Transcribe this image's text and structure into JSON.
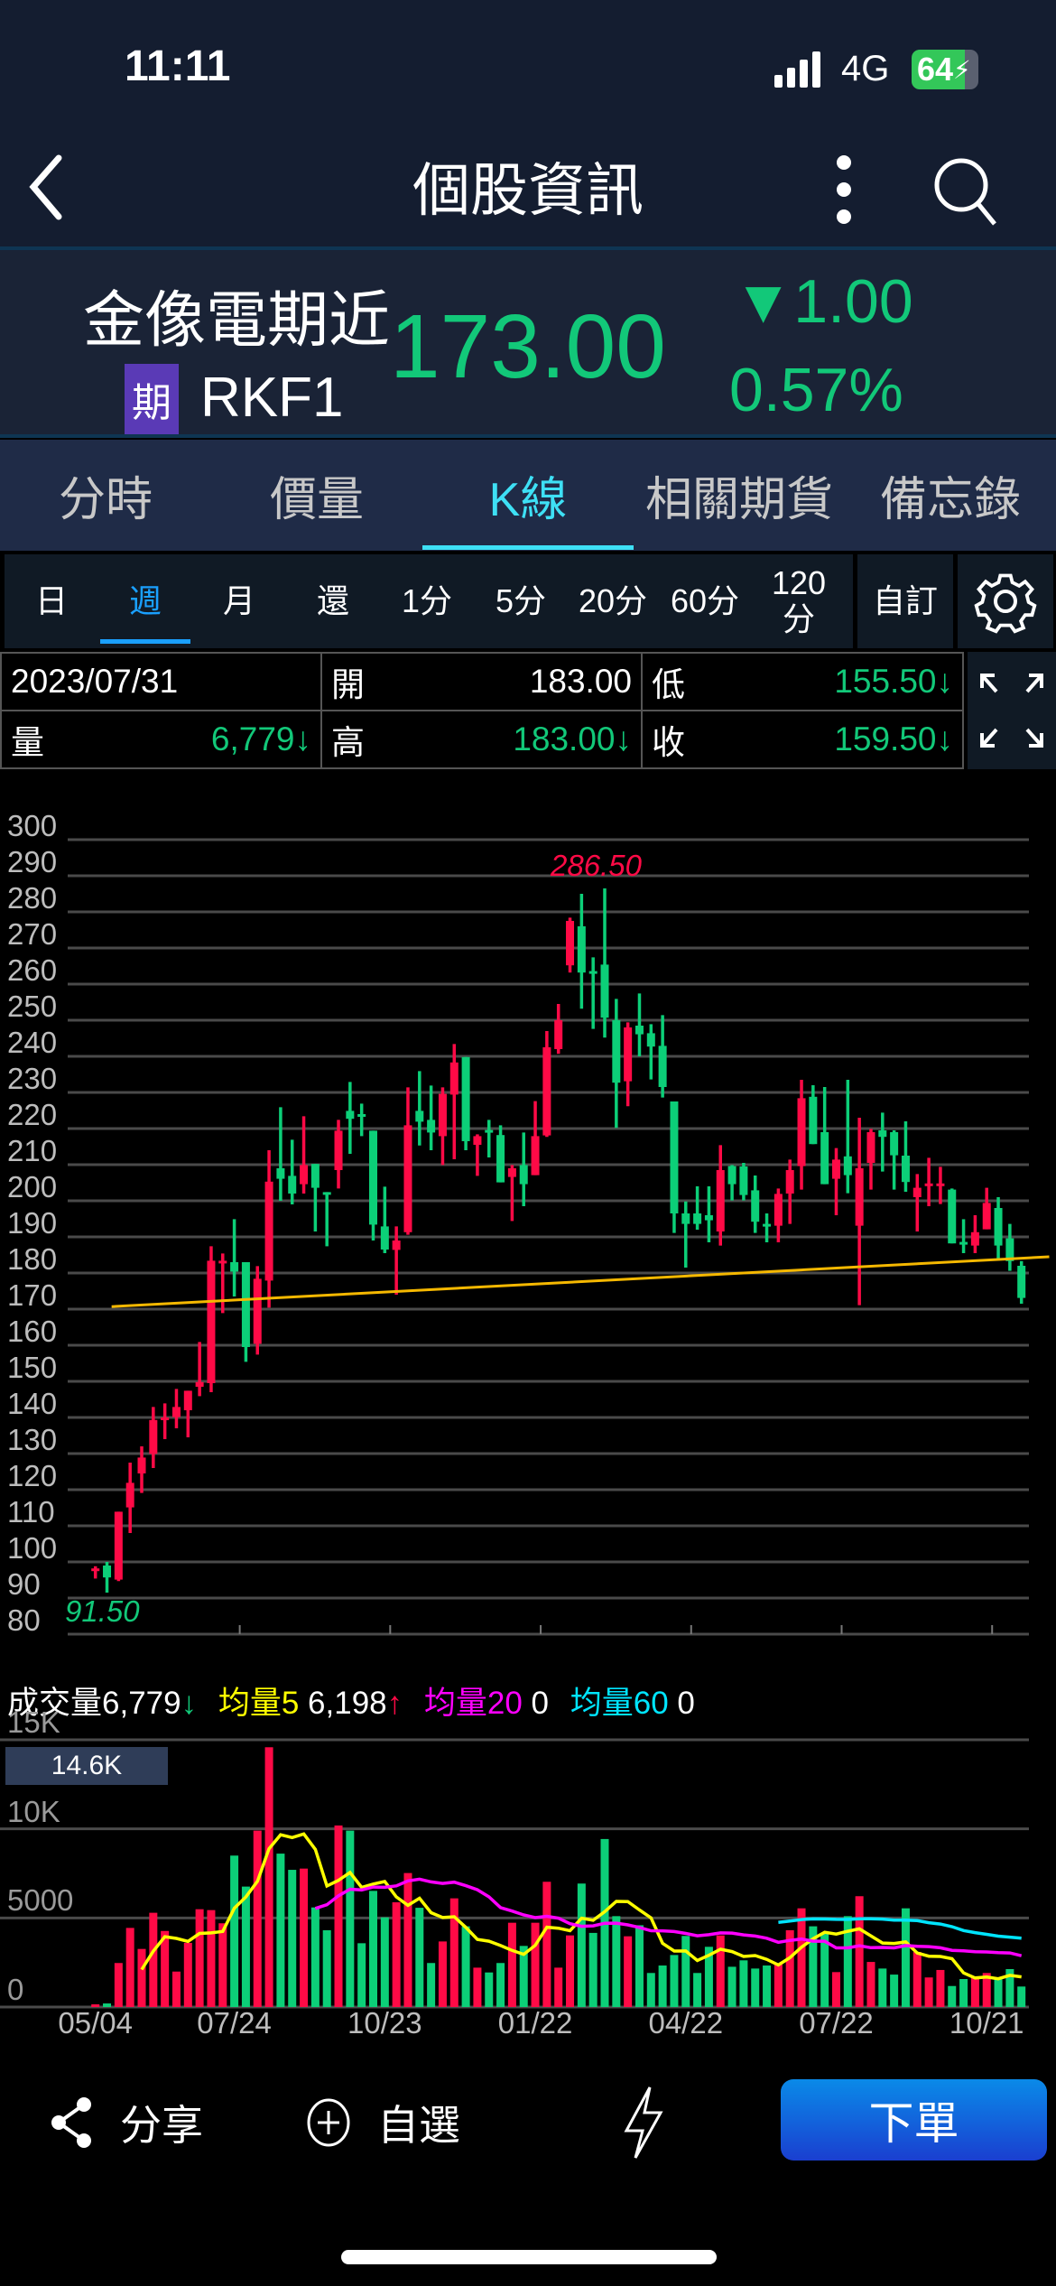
{
  "status": {
    "time": "11:11",
    "network": "4G",
    "battery": "64"
  },
  "nav": {
    "title": "個股資訊"
  },
  "quote": {
    "name": "金像電期近",
    "badge": "期",
    "symbol": "RKF1",
    "price": "173.00",
    "change": "▼1.00",
    "change_pct": "0.57%"
  },
  "tabs": [
    {
      "label": "分時"
    },
    {
      "label": "價量"
    },
    {
      "label": "K線"
    },
    {
      "label": "相關期貨"
    },
    {
      "label": "備忘錄"
    }
  ],
  "periods": [
    {
      "label": "日"
    },
    {
      "label": "週"
    },
    {
      "label": "月"
    },
    {
      "label": "還"
    },
    {
      "label": "1分"
    },
    {
      "label": "5分"
    },
    {
      "label": "20分"
    },
    {
      "label": "60分"
    },
    {
      "label": "120\n分"
    }
  ],
  "custom_label": "自訂",
  "info": {
    "date": "2023/07/31",
    "open_label": "開",
    "open": "183.00",
    "low_label": "低",
    "low": "155.50↓",
    "vol_label": "量",
    "vol": "6,779↓",
    "high_label": "高",
    "high": "183.00↓",
    "close_label": "收",
    "close": "159.50↓"
  },
  "colors": {
    "up": "#ff0a46",
    "down": "#0ccf78",
    "trend": "#f5b800",
    "ma5": "#ffff00",
    "ma20": "#ff00ff",
    "ma60": "#00e5ff",
    "accent": "#1aa0ff"
  },
  "chart_data": {
    "type": "candlestick",
    "yticks": [
      "300",
      "290",
      "280",
      "270",
      "260",
      "250",
      "240",
      "230",
      "220",
      "210",
      "200",
      "190",
      "180",
      "170",
      "160",
      "150",
      "140",
      "130",
      "120",
      "110",
      "100",
      "90",
      "80"
    ],
    "ylim": [
      80,
      300
    ],
    "max_label": "286.50",
    "min_label": "91.50",
    "candles": [
      [
        97.5,
        98.8,
        95.4,
        98.2
      ],
      [
        99.0,
        100.0,
        91.5,
        95.7
      ],
      [
        95.1,
        113.9,
        94.7,
        113.9
      ],
      [
        115.1,
        127.5,
        108.0,
        121.9
      ],
      [
        124.5,
        132.0,
        119.1,
        128.9
      ],
      [
        129.9,
        142.9,
        126.0,
        139.3
      ],
      [
        139.6,
        143.9,
        134.0,
        140.0
      ],
      [
        140.1,
        147.9,
        137.0,
        142.9
      ],
      [
        142.0,
        147.4,
        134.5,
        147.4
      ],
      [
        148.5,
        160.9,
        145.9,
        149.8
      ],
      [
        149.5,
        187.4,
        147.0,
        183.4
      ],
      [
        183.0,
        185.4,
        168.9,
        183.4
      ],
      [
        183.0,
        194.9,
        173.5,
        180.4
      ],
      [
        183.0,
        183.0,
        155.4,
        159.5
      ],
      [
        160.4,
        181.9,
        157.4,
        178.4
      ],
      [
        177.9,
        214.0,
        170.4,
        205.3
      ],
      [
        209.0,
        225.9,
        200.0,
        206.1
      ],
      [
        206.9,
        216.9,
        199.0,
        202.0
      ],
      [
        204.6,
        223.4,
        202.0,
        209.9
      ],
      [
        210.2,
        210.2,
        191.5,
        203.6
      ],
      [
        202.4,
        202.4,
        187.4,
        202.0
      ],
      [
        208.5,
        222.4,
        203.4,
        219.4
      ],
      [
        224.9,
        232.9,
        213.0,
        222.7
      ],
      [
        224.0,
        226.9,
        217.9,
        223.6
      ],
      [
        219.4,
        219.4,
        189.0,
        193.4
      ],
      [
        192.9,
        203.9,
        185.5,
        186.5
      ],
      [
        186.4,
        192.9,
        174.0,
        189.0
      ],
      [
        191.3,
        231.4,
        190.6,
        220.9
      ],
      [
        224.9,
        235.9,
        215.3,
        221.9
      ],
      [
        222.4,
        231.9,
        214.0,
        218.9
      ],
      [
        217.9,
        231.4,
        209.9,
        229.6
      ],
      [
        229.4,
        243.4,
        211.5,
        238.3
      ],
      [
        239.8,
        239.8,
        214.0,
        216.5
      ],
      [
        215.5,
        218.4,
        206.9,
        217.9
      ],
      [
        219.6,
        222.4,
        212.0,
        219.2
      ],
      [
        218.2,
        220.9,
        205.1,
        205.1
      ],
      [
        206.6,
        209.9,
        194.4,
        209.0
      ],
      [
        209.9,
        218.9,
        198.5,
        204.6
      ],
      [
        207.1,
        227.6,
        207.1,
        217.9
      ],
      [
        218.1,
        247.0,
        217.7,
        242.5
      ],
      [
        242.0,
        254.5,
        240.7,
        250.0
      ],
      [
        265.2,
        278.4,
        263.2,
        277.5
      ],
      [
        276.0,
        285.0,
        253.2,
        263.2
      ],
      [
        263.6,
        267.4,
        247.6,
        263.2
      ],
      [
        265.4,
        286.5,
        245.2,
        250.7
      ],
      [
        250.0,
        255.9,
        220.2,
        232.7
      ],
      [
        233.1,
        249.4,
        226.2,
        248.0
      ],
      [
        248.5,
        257.4,
        240.0,
        246.1
      ],
      [
        246.4,
        248.9,
        233.6,
        242.7
      ],
      [
        242.9,
        251.4,
        228.6,
        231.5
      ],
      [
        227.5,
        227.5,
        191.1,
        196.5
      ],
      [
        196.5,
        199.8,
        181.5,
        193.6
      ],
      [
        196.5,
        204.0,
        192.0,
        193.6
      ],
      [
        196.0,
        204.0,
        188.5,
        194.6
      ],
      [
        191.5,
        215.4,
        187.6,
        208.5
      ],
      [
        209.6,
        209.9,
        200.1,
        204.6
      ],
      [
        209.5,
        210.5,
        200.1,
        201.6
      ],
      [
        202.9,
        207.0,
        191.1,
        194.2
      ],
      [
        193.6,
        196.5,
        188.5,
        193.2
      ],
      [
        193.1,
        203.4,
        188.5,
        201.9
      ],
      [
        202.0,
        211.4,
        193.6,
        208.5
      ],
      [
        209.6,
        233.5,
        203.1,
        228.4
      ],
      [
        228.8,
        232.0,
        215.7,
        215.7
      ],
      [
        219.0,
        231.5,
        204.6,
        204.6
      ],
      [
        206.1,
        214.6,
        196.0,
        211.4
      ],
      [
        212.3,
        233.5,
        202.1,
        207.1
      ],
      [
        193.1,
        223.0,
        171.1,
        209.0
      ],
      [
        210.5,
        219.9,
        203.1,
        219.0
      ],
      [
        219.5,
        224.4,
        208.1,
        217.7
      ],
      [
        219.0,
        219.5,
        203.1,
        212.6
      ],
      [
        212.5,
        222.0,
        202.5,
        205.2
      ],
      [
        201.0,
        207.4,
        191.5,
        203.6
      ],
      [
        204.5,
        211.9,
        198.5,
        204.8
      ],
      [
        204.6,
        209.4,
        199.1,
        204.8
      ],
      [
        203.1,
        203.4,
        188.2,
        188.2
      ],
      [
        188.6,
        194.9,
        185.5,
        188.2
      ],
      [
        187.6,
        196.0,
        185.5,
        191.3
      ],
      [
        192.1,
        203.6,
        192.1,
        199.4
      ],
      [
        198.0,
        201.0,
        184.0,
        187.6
      ],
      [
        189.6,
        193.6,
        180.6,
        183.3
      ],
      [
        182.0,
        183.3,
        171.5,
        173.1
      ]
    ],
    "trendline": [
      [
        1.4,
        170.7
      ],
      [
        82.4,
        184.5
      ]
    ],
    "volumes": [
      150,
      200,
      2470,
      4440,
      3260,
      5290,
      4270,
      1990,
      3600,
      5490,
      5440,
      4700,
      8500,
      6760,
      9900,
      14580,
      8610,
      7700,
      7770,
      5590,
      4310,
      10190,
      9900,
      3580,
      6520,
      5030,
      5880,
      7520,
      5570,
      2470,
      3680,
      6100,
      4530,
      2210,
      1940,
      2470,
      4730,
      3430,
      4730,
      7030,
      2210,
      4020,
      6930,
      4160,
      9430,
      5100,
      3970,
      4590,
      1910,
      2330,
      2920,
      3990,
      1910,
      3380,
      4020,
      2260,
      2620,
      2160,
      2330,
      2450,
      4310,
      5540,
      4530,
      4140,
      1960,
      5100,
      6220,
      2530,
      2160,
      1820,
      5540,
      3090,
      1660,
      2080,
      1180,
      1570,
      1660,
      1910,
      1620,
      2130,
      1150
    ],
    "vol_yticks": [
      {
        "label": "15K",
        "v": 15000
      },
      {
        "label": "10K",
        "v": 10000
      },
      {
        "label": "5000",
        "v": 5000
      },
      {
        "label": "0",
        "v": 0
      }
    ],
    "vol_max_label": "14.6K",
    "xticks": [
      {
        "i": 0,
        "label": "05/04"
      },
      {
        "i": 12,
        "label": "07/24"
      },
      {
        "i": 25,
        "label": "10/23"
      },
      {
        "i": 38,
        "label": "01/22"
      },
      {
        "i": 51,
        "label": "04/22"
      },
      {
        "i": 64,
        "label": "07/22"
      },
      {
        "i": 77,
        "label": "10/21"
      }
    ],
    "legend": {
      "vol_label": "成交量",
      "vol": "6,779",
      "vol_arrow": "↓",
      "ma5_label": "均量5",
      "ma5": "6,198",
      "ma5_arrow": "↑",
      "ma20_label": "均量20",
      "ma20": "0",
      "ma60_label": "均量60",
      "ma60": "0"
    }
  },
  "bottom": {
    "share": "分享",
    "watchlist": "自選",
    "order": "下單"
  }
}
